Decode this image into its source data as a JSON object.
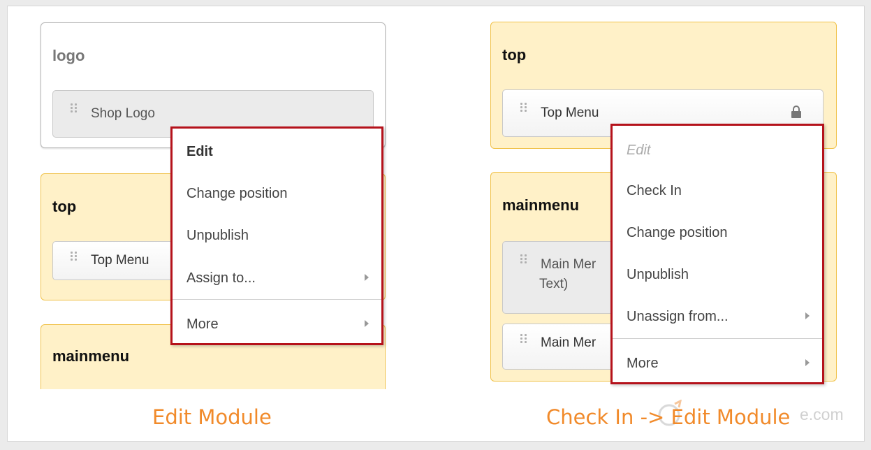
{
  "left_panel": {
    "logo_card": {
      "title": "logo",
      "module": "Shop Logo"
    },
    "top_card": {
      "title": "top",
      "module": "Top Menu"
    },
    "mainmenu_card": {
      "title": "mainmenu"
    },
    "context_menu": {
      "items": [
        "Edit",
        "Change position",
        "Unpublish",
        "Assign to...",
        "More"
      ]
    },
    "caption": "Edit Module"
  },
  "right_panel": {
    "top_card": {
      "title": "top",
      "module": "Top Menu",
      "lock_icon": "lock-icon"
    },
    "mainmenu_card": {
      "title": "mainmenu",
      "module_1_line1": "Main Mer",
      "module_1_line2": "Text)",
      "module_2": "Main Mer"
    },
    "context_menu": {
      "items": [
        "Edit",
        "Check In",
        "Change position",
        "Unpublish",
        "Unassign from...",
        "More"
      ]
    },
    "caption": "Check In -> Edit Module"
  },
  "watermark": "e.com",
  "colors": {
    "accent_border": "#b5121b",
    "caption": "#f18a2a",
    "card_yellow": "#fff1c8"
  }
}
